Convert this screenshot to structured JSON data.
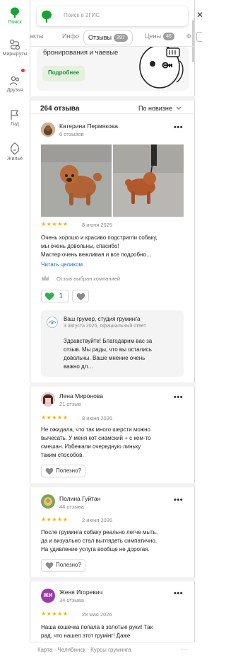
{
  "nav": {
    "items": [
      {
        "label": "Поиск",
        "icon": "leaf-pin-icon",
        "active": true
      },
      {
        "label": "Маршруты",
        "icon": "route-icon"
      },
      {
        "label": "Друзья",
        "icon": "friends-icon",
        "notification": true
      },
      {
        "label": "Гид",
        "icon": "flag-icon"
      },
      {
        "label": "Жильё",
        "icon": "house-icon"
      }
    ]
  },
  "search": {
    "placeholder": "Поиск в 2ГИС"
  },
  "tabs": [
    {
      "label": "такты"
    },
    {
      "label": "Инфо"
    },
    {
      "label": "Отзывы",
      "count": "297",
      "active": true
    },
    {
      "label": "Цены",
      "count": "46"
    },
    {
      "label": "Ф"
    }
  ],
  "promo": {
    "text": "бронирования и чаевые",
    "button": "Подробнее"
  },
  "reviews_header": {
    "count": "264 отзыва",
    "sort": "По новизне"
  },
  "reviews": [
    {
      "name": "Катерина Пермякова",
      "count": "6 отзывов",
      "rating": 5,
      "date": "8 июня 2025",
      "text": [
        "Очень хорошо и красиво подстригли собаку,",
        "мы очень довольны, спасибо!",
        "Мастер очень вежливая и все подробно…"
      ],
      "read_more": "Читать целиком",
      "company_choice": "Отзыв выбран компанией",
      "likes": "1",
      "reply": {
        "author": "Ваш грумер, студия груминга",
        "meta": "3 августа 2025, официальный ответ",
        "text": [
          "Здравствуйте! Благодарим вас за",
          "отзыв. Мы рады, что вы остались",
          "довольны. Ваше мнение очень",
          "важно дл…"
        ]
      }
    },
    {
      "name": "Лена Миронова",
      "count": "21 отзыв",
      "rating": 5,
      "date": "8 июня 2026",
      "text": [
        "Не ожидала, что так много шерсти можно",
        "вычесать. У меня кот сиамский + с кем-то",
        "смешан. Избежали очередную линьку",
        "таким способов."
      ],
      "useful": "Полезно?"
    },
    {
      "name": "Полина Гуйтан",
      "count": "44 отзыва",
      "rating": 5,
      "date": "2 июня 2026",
      "text": [
        "После груминга собаку реально легче мыть,",
        "да и визуально стал выглядеть симпатично.",
        "На удивление услуга вообще не дорогая."
      ],
      "useful": "Полезно?"
    },
    {
      "name": "Женя Игоревич",
      "initials": "ЖИ",
      "count": "34 отзыва",
      "rating": 5,
      "date": "28 мая 2026",
      "text": [
        "Наша кошечка попала в золотые руки! Так",
        "рад, что нашел этот грумінг! Даже"
      ]
    }
  ],
  "footer": {
    "breadcrumb": "Карта · Челябинск · Курсы груминга",
    "dots": "..."
  },
  "colors": {
    "accent": "#1ba136",
    "star": "#f4b400",
    "link": "#1f6fc4",
    "avatar_zhi": "#9c3aa8"
  }
}
